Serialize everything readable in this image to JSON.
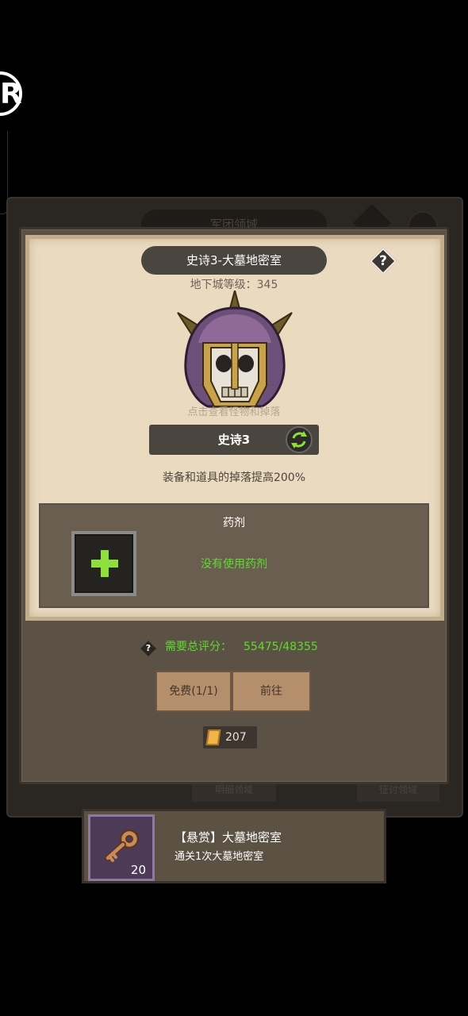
{
  "background": {
    "title": "军团领域",
    "button1": "明细领域",
    "button2": "征讨领域"
  },
  "dungeon": {
    "title": "史诗3-大墓地密室",
    "help_label": "?",
    "level_label": "地下城等级：345",
    "tap_hint": "点击查看怪物和掉落",
    "difficulty": "史诗3",
    "drop_bonus": "装备和道具的掉落提高200%",
    "potion": {
      "title": "药剂",
      "status": "没有使用药剂"
    },
    "score": {
      "label": "需要总评分：",
      "value": "55475/48355",
      "icon_label": "?"
    },
    "buttons": {
      "free": "免费(1/1)",
      "go": "前往"
    },
    "ticket_count": "207"
  },
  "quest": {
    "title": "【悬赏】大墓地密室",
    "description": "通关1次大墓地密室",
    "item_count": "20",
    "item_icon": "key-icon"
  },
  "colors": {
    "accent_green": "#5fdc2e",
    "parchment": "#eadac0",
    "panel_brown": "#5b5144",
    "button_brown": "#b58f6c"
  }
}
